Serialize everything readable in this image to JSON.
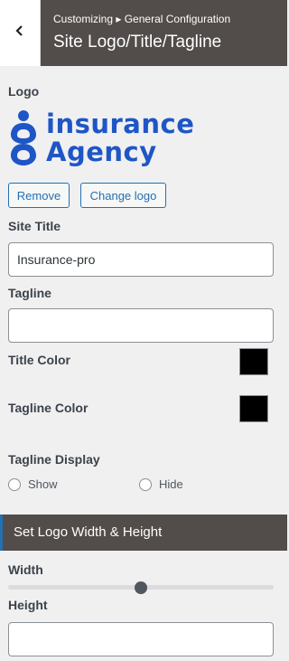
{
  "header": {
    "breadcrumb": "Customizing ▸ General Configuration",
    "title": "Site Logo/Title/Tagline",
    "back_icon": "chevron-left-icon"
  },
  "logo": {
    "label": "Logo",
    "line1": "insurance",
    "line2": "Agency",
    "brand_color": "#1e56c6",
    "remove_label": "Remove",
    "change_label": "Change logo"
  },
  "site_title": {
    "label": "Site Title",
    "value": "Insurance-pro"
  },
  "tagline": {
    "label": "Tagline",
    "value": ""
  },
  "title_color": {
    "label": "Title Color",
    "value": "#000000"
  },
  "tagline_color": {
    "label": "Tagline Color",
    "value": "#000000"
  },
  "tagline_display": {
    "label": "Tagline Display",
    "show_label": "Show",
    "hide_label": "Hide"
  },
  "logo_size": {
    "section_title": "Set Logo Width & Height",
    "width_label": "Width",
    "width_slider_fraction": 0.5,
    "height_label": "Height",
    "height_value": ""
  }
}
